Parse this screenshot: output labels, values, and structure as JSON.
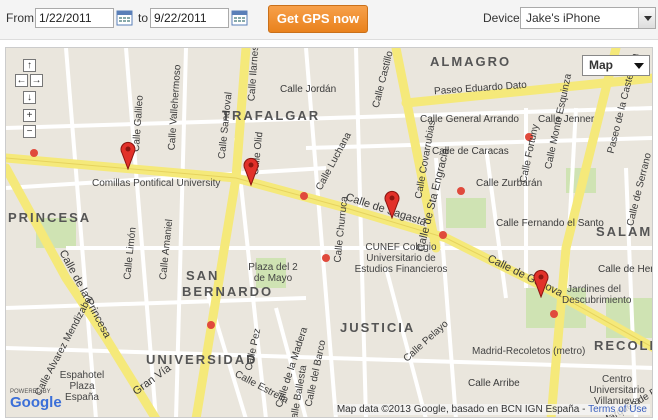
{
  "toolbar": {
    "from_label": "From",
    "from_date": "1/22/2011",
    "to_label": "to",
    "to_date": "9/22/2011",
    "gps_button": "Get GPS now",
    "device_label": "Device",
    "device_value": "Jake's iPhone"
  },
  "map": {
    "type_control": "Map",
    "attribution": "Map data ©2013 Google, basado en BCN IGN España",
    "terms": "Terms of Use",
    "powered_by": "POWERED BY",
    "logo": "Google",
    "districts": [
      "TRAFALGAR",
      "ALMAGRO",
      "PRINCESA",
      "SAN",
      "BERNARDO",
      "JUSTICIA",
      "UNIVERSIDAD",
      "SALAMA",
      "RECOLETOS"
    ],
    "streets": [
      "Paseo Eduardo Dato",
      "Calle General Arrando",
      "Calle de Caracas",
      "Calle Zurbarán",
      "Calle Fernando el Santo",
      "Calle de Sagasta",
      "Calle de Génova",
      "Calle de la Princesa",
      "Calle Jordán",
      "Calle Luchana",
      "Calle de Sta Engracia",
      "Calle Covarrubias",
      "Calle Castillo",
      "Calle Fortuny",
      "Calle Jenner",
      "Calle Monte Esquinza",
      "Calle de Hermos",
      "Calle Galileo",
      "Calle Vallehermoso",
      "Calle Limón",
      "Calle Amaniel",
      "Calle Pez",
      "Calle Estrella",
      "Calle Pelayo",
      "Calle Arribe",
      "Calle Alvarez Mendizabal",
      "Gran Vía",
      "Calle del Barco",
      "Calle de la Madera",
      "Calle Ballesta",
      "Calle Churruca",
      "Calle Olid",
      "Calle Sandoval",
      "Calle Ilarnes",
      "Calle de Serrano",
      "Paseo de la Castellana",
      "Calle Marqués de Ensenada"
    ],
    "pois": [
      "Comillas Pontifical University",
      "Plaza del 2 de Mayo",
      "CUNEF Colegio Universitario de Estudios Financieros",
      "Jardines del Descubrimiento",
      "Madrid-Recoletos (metro)",
      "Espahotel Plaza España",
      "Centro Universitario Villanueva"
    ],
    "marker_count": 4
  }
}
